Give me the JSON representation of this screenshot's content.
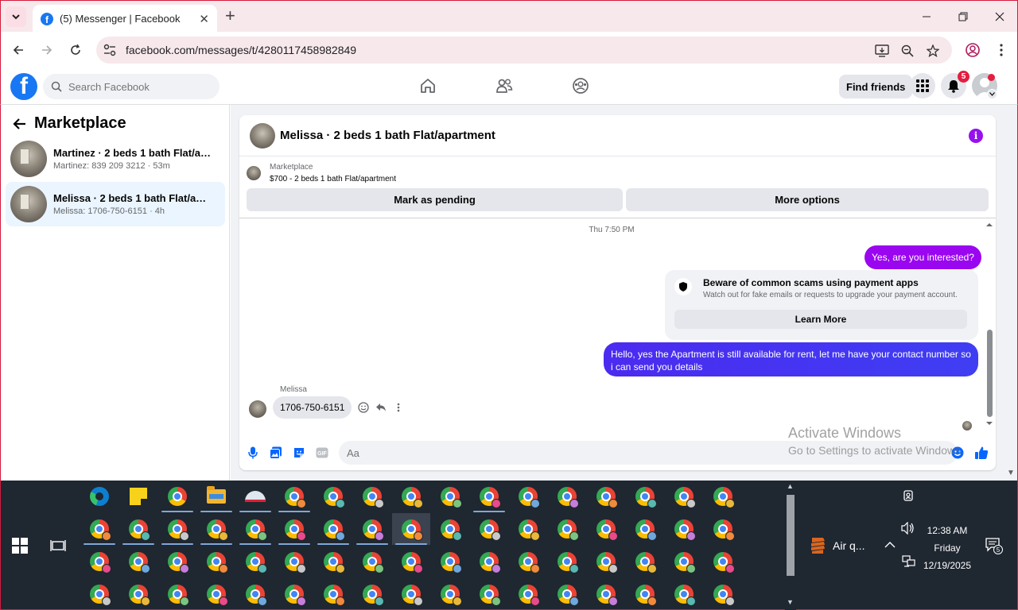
{
  "browser": {
    "tab_title": "(5) Messenger | Facebook",
    "url": "facebook.com/messages/t/4280117458982849"
  },
  "header": {
    "search_placeholder": "Search Facebook",
    "find_friends": "Find friends",
    "notification_count": "5"
  },
  "sidebar": {
    "title": "Marketplace",
    "conversations": [
      {
        "name": "Martinez · 2 beds 1 bath Flat/apart...",
        "preview": "Martinez: 839 209 3212 · 53m"
      },
      {
        "name": "Melissa · 2 beds 1 bath Flat/apart...",
        "preview": "Melissa: 1706-750-6151 · 4h"
      }
    ]
  },
  "chat": {
    "title": "Melissa · 2 beds 1 bath Flat/apartment",
    "marketplace_label": "Marketplace",
    "listing": "$700 - 2 beds 1 bath Flat/apartment",
    "mark_pending": "Mark as pending",
    "more_options": "More options",
    "timestamp": "Thu 7:50 PM",
    "messages": {
      "out_1": "Yes, are you interested?",
      "scam_title": "Beware of common scams using payment apps",
      "scam_sub": "Watch out for fake emails or requests to upgrade your payment account.",
      "learn_more": "Learn More",
      "out_2": "Hello, yes the Apartment is still available for rent, let me have your contact number so i can send you details",
      "sender": "Melissa",
      "in_1": "1706-750-6151"
    },
    "composer_placeholder": "Aa"
  },
  "watermark": {
    "line1": "Activate Windows",
    "line2": "Go to Settings to activate Windows."
  },
  "taskbar": {
    "weather": "Air q...",
    "time": "12:38 AM",
    "day": "Friday",
    "date": "12/19/2025",
    "notifications": "5"
  }
}
